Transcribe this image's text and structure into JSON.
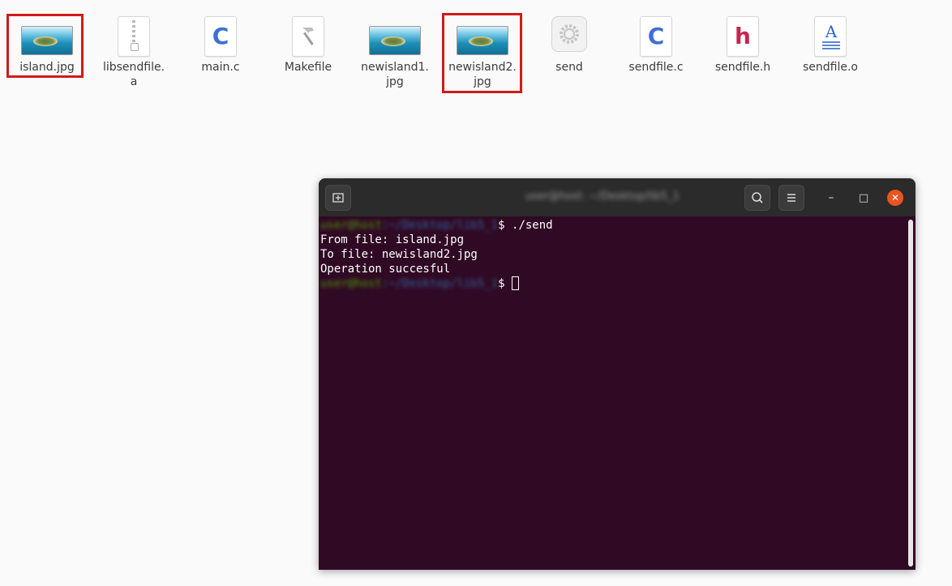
{
  "desktop": {
    "files": [
      {
        "name": "island.jpg",
        "icon": "image-thumbnail-icon",
        "highlighted": true
      },
      {
        "name": "libsendfile.\na",
        "icon": "archive-icon",
        "highlighted": false
      },
      {
        "name": "main.c",
        "icon": "c-source-icon",
        "highlighted": false
      },
      {
        "name": "Makefile",
        "icon": "makefile-icon",
        "highlighted": false
      },
      {
        "name": "newisland1.\njpg",
        "icon": "image-thumbnail-icon",
        "highlighted": false
      },
      {
        "name": "newisland2.\njpg",
        "icon": "image-thumbnail-icon",
        "highlighted": true
      },
      {
        "name": "send",
        "icon": "executable-gear-icon",
        "highlighted": false
      },
      {
        "name": "sendfile.c",
        "icon": "c-source-icon",
        "highlighted": false
      },
      {
        "name": "sendfile.h",
        "icon": "c-header-icon",
        "highlighted": false
      },
      {
        "name": "sendfile.o",
        "icon": "object-file-icon",
        "highlighted": false
      }
    ],
    "glyphs": {
      "c": "C",
      "h": "h",
      "a": "A"
    },
    "highlight_color": "#d11a1a"
  },
  "terminal": {
    "title": "user@host: ~/Desktop/lib5_1",
    "prompt_user": "user@host",
    "prompt_path": ":~/Desktop/lib5_1",
    "prompt_symbol": "$",
    "command": " ./send",
    "output": [
      "From file: island.jpg",
      "To file: newisland2.jpg",
      "Operation succesful"
    ],
    "buttons": {
      "minimize": "–",
      "maximize": "□",
      "close": "✕"
    },
    "colors": {
      "background": "#300a24",
      "titlebar": "#2b2b2b",
      "close": "#e95420",
      "prompt_user": "#4e9a06",
      "prompt_path": "#3465a4"
    }
  }
}
